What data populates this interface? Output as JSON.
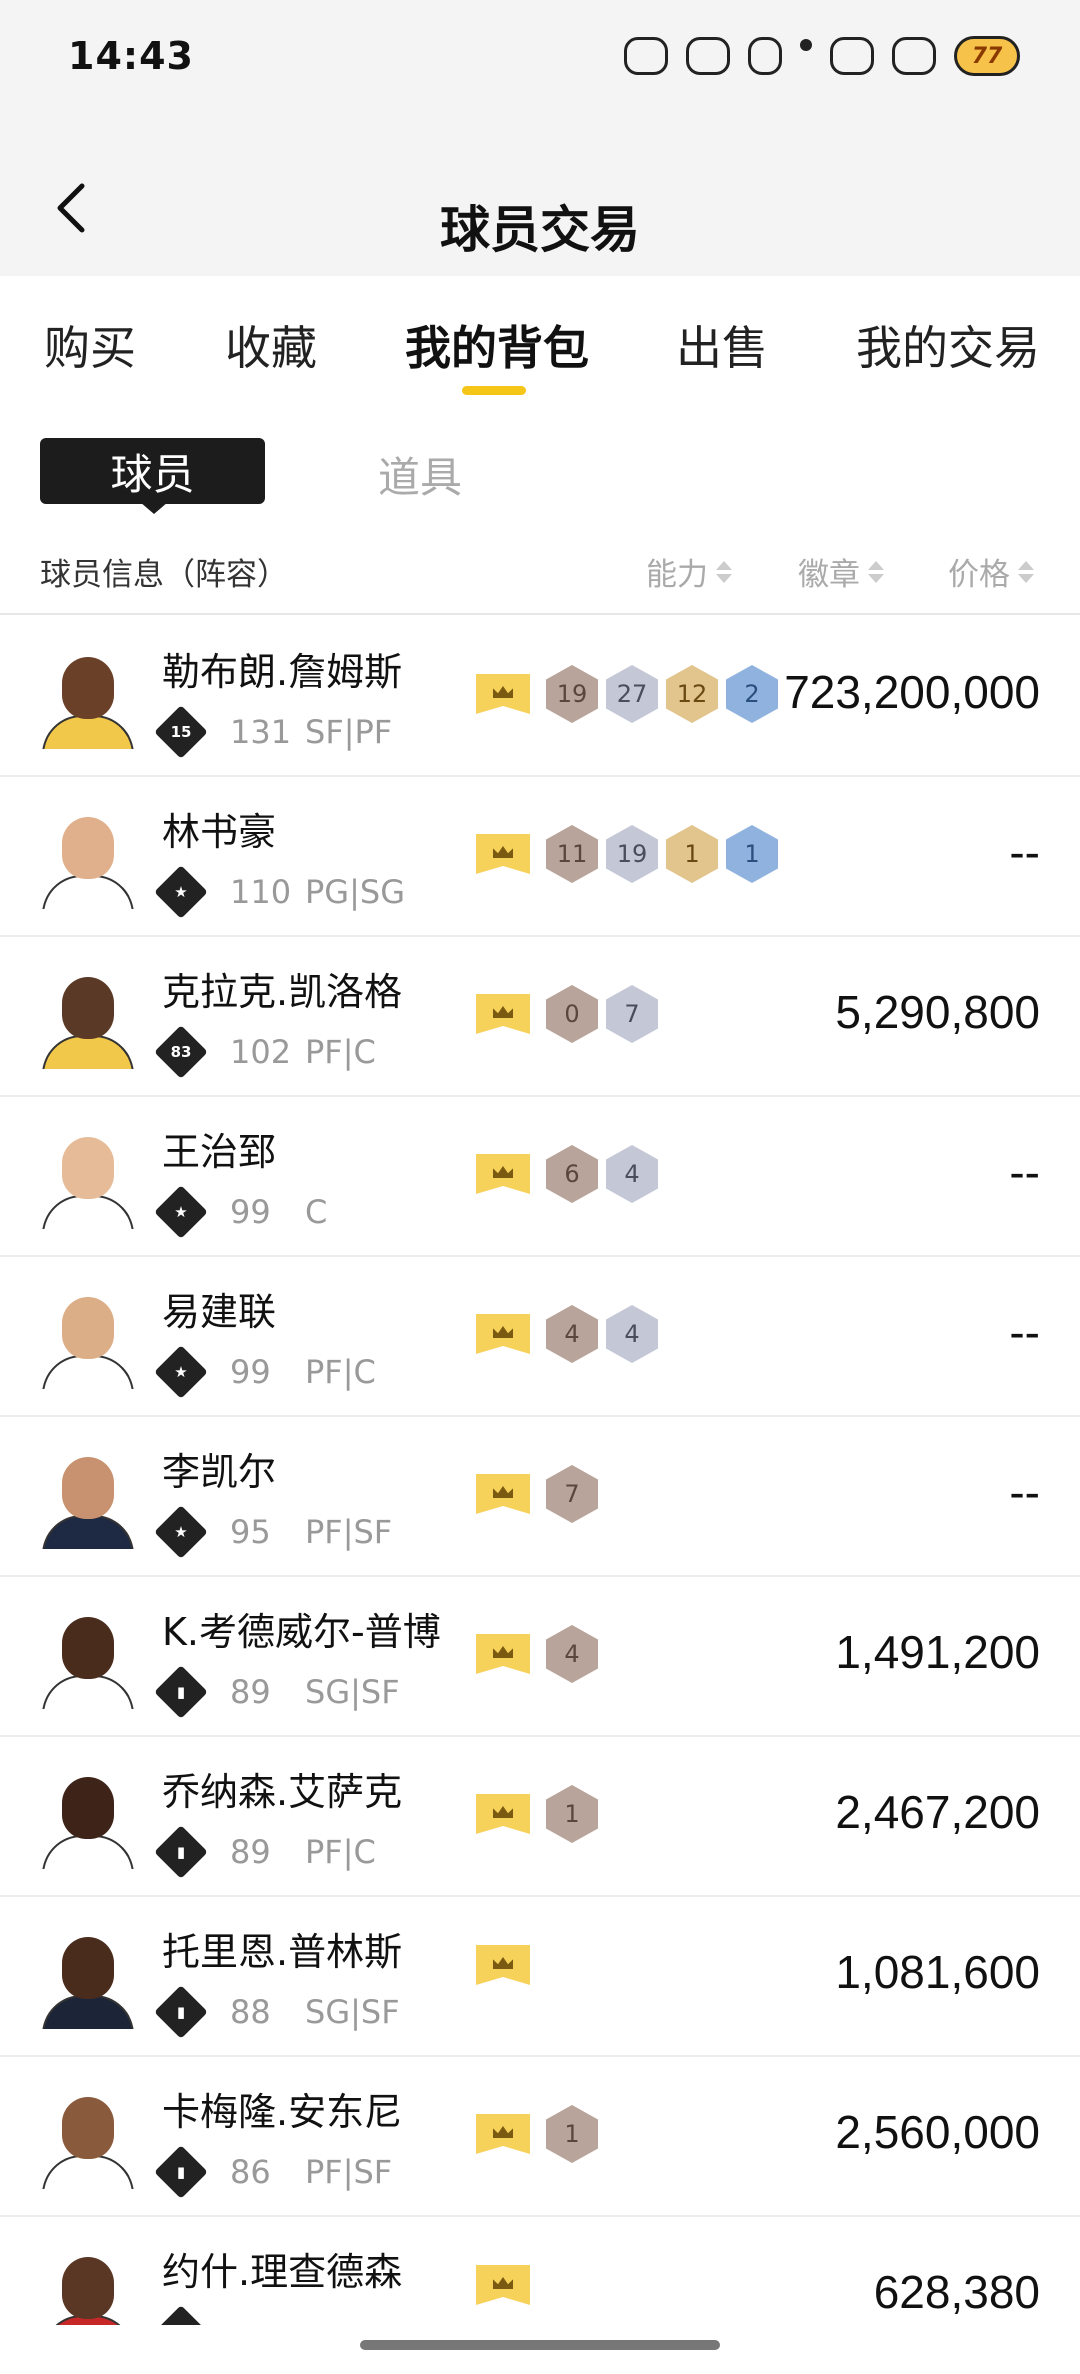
{
  "status_bar": {
    "time": "14:43",
    "badge": "77"
  },
  "header": {
    "title": "球员交易"
  },
  "tabs": [
    "购买",
    "收藏",
    "我的背包",
    "出售",
    "我的交易"
  ],
  "active_tab": "我的背包",
  "subtabs": {
    "player": "球员",
    "item": "道具"
  },
  "columns": {
    "info": "球员信息（阵容）",
    "ability": "能力",
    "badge": "徽章",
    "price": "价格"
  },
  "players": [
    {
      "name": "勒布朗.詹姆斯",
      "tier": "15",
      "rating": "131",
      "position": "SF|PF",
      "badges": [
        {
          "v": "19",
          "t": "bronze"
        },
        {
          "v": "27",
          "t": "silver"
        },
        {
          "v": "12",
          "t": "gold"
        },
        {
          "v": "2",
          "t": "blue"
        }
      ],
      "price": "723,200,000",
      "skin": "#6b4028",
      "jersey": "#f2c84b"
    },
    {
      "name": "林书豪",
      "tier": "★",
      "rating": "110",
      "position": "PG|SG",
      "badges": [
        {
          "v": "11",
          "t": "bronze"
        },
        {
          "v": "19",
          "t": "silver"
        },
        {
          "v": "1",
          "t": "gold"
        },
        {
          "v": "1",
          "t": "blue"
        }
      ],
      "price": "--",
      "skin": "#e0b08c",
      "jersey": "#ffffff"
    },
    {
      "name": "克拉克.凯洛格",
      "tier": "83",
      "rating": "102",
      "position": "PF|C",
      "badges": [
        {
          "v": "0",
          "t": "bronze"
        },
        {
          "v": "7",
          "t": "silver"
        }
      ],
      "price": "5,290,800",
      "skin": "#5a3a26",
      "jersey": "#f2c84b"
    },
    {
      "name": "王治郅",
      "tier": "★",
      "rating": "99",
      "position": "C",
      "badges": [
        {
          "v": "6",
          "t": "bronze"
        },
        {
          "v": "4",
          "t": "silver"
        }
      ],
      "price": "--",
      "skin": "#e6bc98",
      "jersey": "#ffffff"
    },
    {
      "name": "易建联",
      "tier": "★",
      "rating": "99",
      "position": "PF|C",
      "badges": [
        {
          "v": "4",
          "t": "bronze"
        },
        {
          "v": "4",
          "t": "silver"
        }
      ],
      "price": "--",
      "skin": "#dcae88",
      "jersey": "#ffffff"
    },
    {
      "name": "李凯尔",
      "tier": "★",
      "rating": "95",
      "position": "PF|SF",
      "badges": [
        {
          "v": "7",
          "t": "bronze"
        }
      ],
      "price": "--",
      "skin": "#c89270",
      "jersey": "#1e2a44"
    },
    {
      "name": "K.考德威尔-普博",
      "tier": "▮",
      "rating": "89",
      "position": "SG|SF",
      "badges": [
        {
          "v": "4",
          "t": "bronze"
        }
      ],
      "price": "1,491,200",
      "skin": "#4a2c1c",
      "jersey": "#ffffff"
    },
    {
      "name": "乔纳森.艾萨克",
      "tier": "▮",
      "rating": "89",
      "position": "PF|C",
      "badges": [
        {
          "v": "1",
          "t": "bronze"
        }
      ],
      "price": "2,467,200",
      "skin": "#3e2418",
      "jersey": "#ffffff"
    },
    {
      "name": "托里恩.普林斯",
      "tier": "▮",
      "rating": "88",
      "position": "SG|SF",
      "badges": [],
      "price": "1,081,600",
      "skin": "#4a2c1c",
      "jersey": "#1c2438"
    },
    {
      "name": "卡梅隆.安东尼",
      "tier": "▮",
      "rating": "86",
      "position": "PF|SF",
      "badges": [
        {
          "v": "1",
          "t": "bronze"
        }
      ],
      "price": "2,560,000",
      "skin": "#8a5a3c",
      "jersey": "#ffffff"
    },
    {
      "name": "约什.理查德森",
      "tier": "▮",
      "rating": "",
      "position": "",
      "badges": [],
      "price": "628,380",
      "skin": "#5a3624",
      "jersey": "#c62828"
    }
  ]
}
